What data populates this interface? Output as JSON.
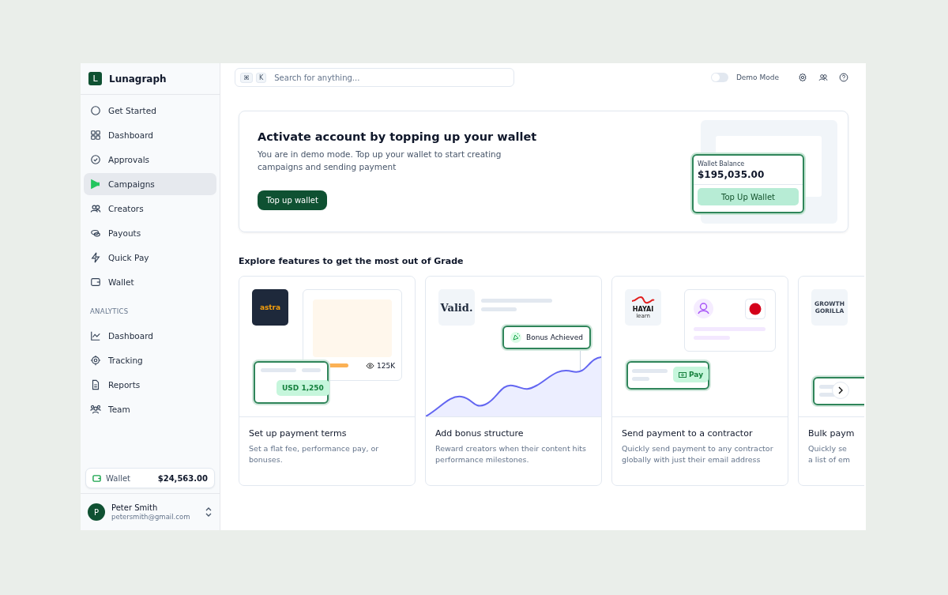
{
  "sidebar": {
    "brand": {
      "initial": "L",
      "name": "Lunagraph"
    },
    "items": [
      {
        "label": "Get Started",
        "selected": false
      },
      {
        "label": "Dashboard",
        "selected": false
      },
      {
        "label": "Approvals",
        "selected": false
      },
      {
        "label": "Campaigns",
        "selected": true
      },
      {
        "label": "Creators",
        "selected": false
      },
      {
        "label": "Payouts",
        "selected": false
      },
      {
        "label": "Quick Pay",
        "selected": false
      },
      {
        "label": "Wallet",
        "selected": false
      }
    ],
    "section": "ANALYTICS",
    "analytics_items": [
      {
        "label": "Dashboard",
        "selected": false
      },
      {
        "label": "Tracking",
        "selected": false
      },
      {
        "label": "Reports",
        "selected": false
      },
      {
        "label": "Team",
        "selected": false
      }
    ],
    "wallet": {
      "label": "Wallet",
      "amount": "$24,563.00"
    },
    "user": {
      "initial": "P",
      "name": "Peter Smith",
      "email": "petersmith@gmail.com"
    }
  },
  "topbar": {
    "keys": [
      "⌘",
      "K"
    ],
    "search": {
      "placeholder": "Search for anything..."
    },
    "demo_toggle": {
      "label": "Demo Mode",
      "on": false
    }
  },
  "banner": {
    "title": "Activate account by topping up your wallet",
    "text": "You are in demo mode. Top up your wallet to start creating campaigns and sending payment",
    "button": "Top up wallet",
    "balance_label": "Wallet Balance",
    "balance": "$195,035.00",
    "balance_button": "Top Up Wallet"
  },
  "features": {
    "heading": "Explore features to get the most out of Grade",
    "cards": [
      {
        "kind": "terms",
        "logo": [
          "astra"
        ],
        "stat": "125K",
        "badge": "USD 1,250",
        "title": "Set up payment terms",
        "lines": [
          "Set a flat fee, performance pay, or",
          "bonuses."
        ]
      },
      {
        "kind": "bonus",
        "logo": [
          "Valid."
        ],
        "badge": "Bonus Achieved",
        "title": "Add bonus structure",
        "lines": [
          "Reward creators when their content hits",
          "performance milestones."
        ]
      },
      {
        "kind": "contractor",
        "logo": [
          "HAYAI",
          "learn"
        ],
        "badge": "Pay",
        "title": "Send payment to a contractor",
        "lines": [
          "Quickly send payment to any contractor",
          "globally with just their email address"
        ]
      },
      {
        "kind": "bulk",
        "logo": [
          "GROWTH",
          "GORILLA"
        ],
        "title": "Bulk paym",
        "lines": [
          "Quickly se",
          "a list of em"
        ]
      }
    ]
  }
}
